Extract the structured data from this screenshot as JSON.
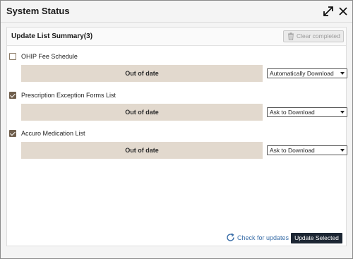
{
  "window": {
    "title": "System Status"
  },
  "panel": {
    "title": "Update List Summary(3)",
    "clear_label": "Clear completed"
  },
  "items": [
    {
      "label": "OHIP Fee Schedule",
      "checked": false,
      "status": "Out of date",
      "option": "Automatically Download"
    },
    {
      "label": "Prescription Exception Forms List",
      "checked": true,
      "status": "Out of date",
      "option": "Ask to Download"
    },
    {
      "label": "Accuro Medication List",
      "checked": true,
      "status": "Out of date",
      "option": "Ask to Download"
    }
  ],
  "footer": {
    "check_label": "Check for updates",
    "update_label": "Update Selected"
  },
  "colors": {
    "status_bg": "#e2d9ce",
    "checkbox_checked": "#6f5e4c",
    "primary_button": "#1c2633",
    "link": "#3a6ea8"
  }
}
